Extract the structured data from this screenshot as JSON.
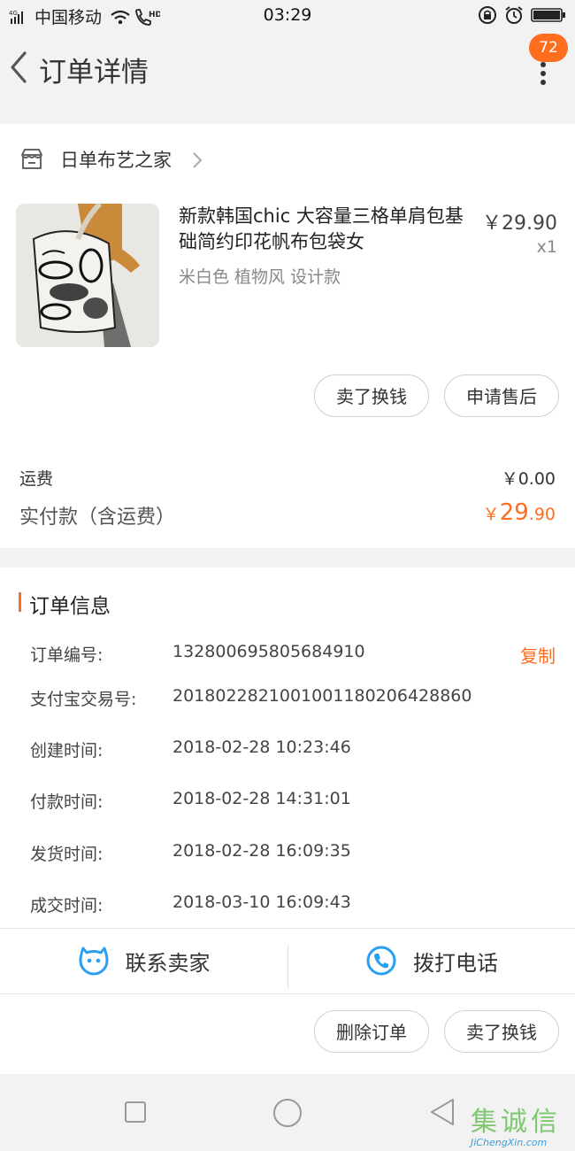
{
  "status_bar": {
    "carrier": "中国移动",
    "time": "03:29"
  },
  "nav": {
    "title": "订单详情",
    "badge": "72"
  },
  "shop": {
    "name": "日单布艺之家"
  },
  "product": {
    "title": "新款韩国chic 大容量三格单肩包基础简约印花帆布包袋女",
    "price": "￥29.90",
    "qty": "x1",
    "sku": "米白色 植物风 设计款"
  },
  "actions_top": {
    "sell": "卖了换钱",
    "after_sale": "申请售后"
  },
  "payment": {
    "shipping_label": "运费",
    "shipping_value": "￥0.00",
    "paid_label": "实付款（含运费）",
    "paid_currency": "￥",
    "paid_int": "29",
    "paid_dec": ".90"
  },
  "order_info": {
    "section_title": "订单信息",
    "copy_label": "复制",
    "rows": [
      {
        "label": "订单编号:",
        "value": "132800695805684910"
      },
      {
        "label": "支付宝交易号:",
        "value": "2018022821001001180206428860"
      },
      {
        "label": "创建时间:",
        "value": "2018-02-28 10:23:46"
      },
      {
        "label": "付款时间:",
        "value": "2018-02-28 14:31:01"
      },
      {
        "label": "发货时间:",
        "value": "2018-02-28 16:09:35"
      },
      {
        "label": "成交时间:",
        "value": "2018-03-10 16:09:43"
      }
    ]
  },
  "contact": {
    "seller": "联系卖家",
    "call": "拨打电话"
  },
  "actions_bottom": {
    "delete": "删除订单",
    "sell": "卖了换钱"
  },
  "watermark": {
    "text": "JiChengXin.com",
    "logo_text": "集诚信"
  },
  "colors": {
    "accent": "#ff6d1f",
    "contact_icon": "#2b9ff1"
  },
  "icons": [
    "signal-icon",
    "wifi-icon",
    "call-hd-icon",
    "lock-rotation-icon",
    "alarm-icon",
    "battery-icon",
    "back-icon",
    "more-icon",
    "shop-icon",
    "chevron-right-icon",
    "chat-face-icon",
    "phone-icon",
    "square-nav-icon",
    "circle-nav-icon",
    "back-nav-icon"
  ]
}
